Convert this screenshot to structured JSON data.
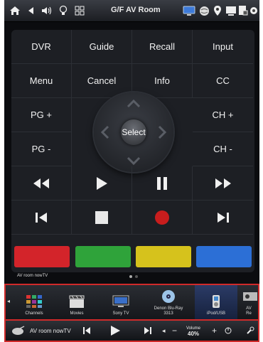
{
  "header": {
    "room_title": "G/F AV Room",
    "left_icons": [
      "home-icon",
      "back-icon",
      "volume-icon",
      "bulb-icon",
      "grid-icon"
    ],
    "right_icons": [
      "monitor-icon",
      "globe-icon",
      "location-icon",
      "screen-icon",
      "document-lock-icon",
      "settings-icon"
    ]
  },
  "remote": {
    "rows": [
      [
        "DVR",
        "Guide",
        "Recall",
        "Input"
      ],
      [
        "Menu",
        "Cancel",
        "Info",
        "CC"
      ],
      [
        "PG +",
        "",
        "",
        "CH +"
      ],
      [
        "PG -",
        "",
        "",
        "CH -"
      ]
    ],
    "select_label": "Select",
    "transport_row1": [
      "rewind-icon",
      "play-icon",
      "pause-icon",
      "fast-forward-icon"
    ],
    "transport_row2": [
      "skip-previous-icon",
      "stop-icon",
      "record-icon",
      "skip-next-icon"
    ],
    "color_buttons": [
      "#d3242a",
      "#2fa33a",
      "#d6c21c",
      "#2c6fd6"
    ],
    "record_color": "#c81d1d"
  },
  "page_label": "AV room nowTV",
  "page_indicator": {
    "count": 2,
    "active": 1
  },
  "sources": {
    "items": [
      {
        "label": "Channels",
        "icon": "channels-grid-icon"
      },
      {
        "label": "Movies",
        "icon": "clapperboard-icon"
      },
      {
        "label": "Sony TV",
        "icon": "tv-icon"
      },
      {
        "label": "Denon Blu-Ray\n3313",
        "icon": "disc-icon"
      },
      {
        "label": "iPod/USB",
        "icon": "ipod-icon"
      },
      {
        "label": "AV\nRe",
        "icon": "receiver-icon"
      }
    ],
    "active_index": 4
  },
  "now_playing": {
    "source_name": "AV room nowTV",
    "volume_label": "Volume",
    "volume_value": "40%"
  }
}
